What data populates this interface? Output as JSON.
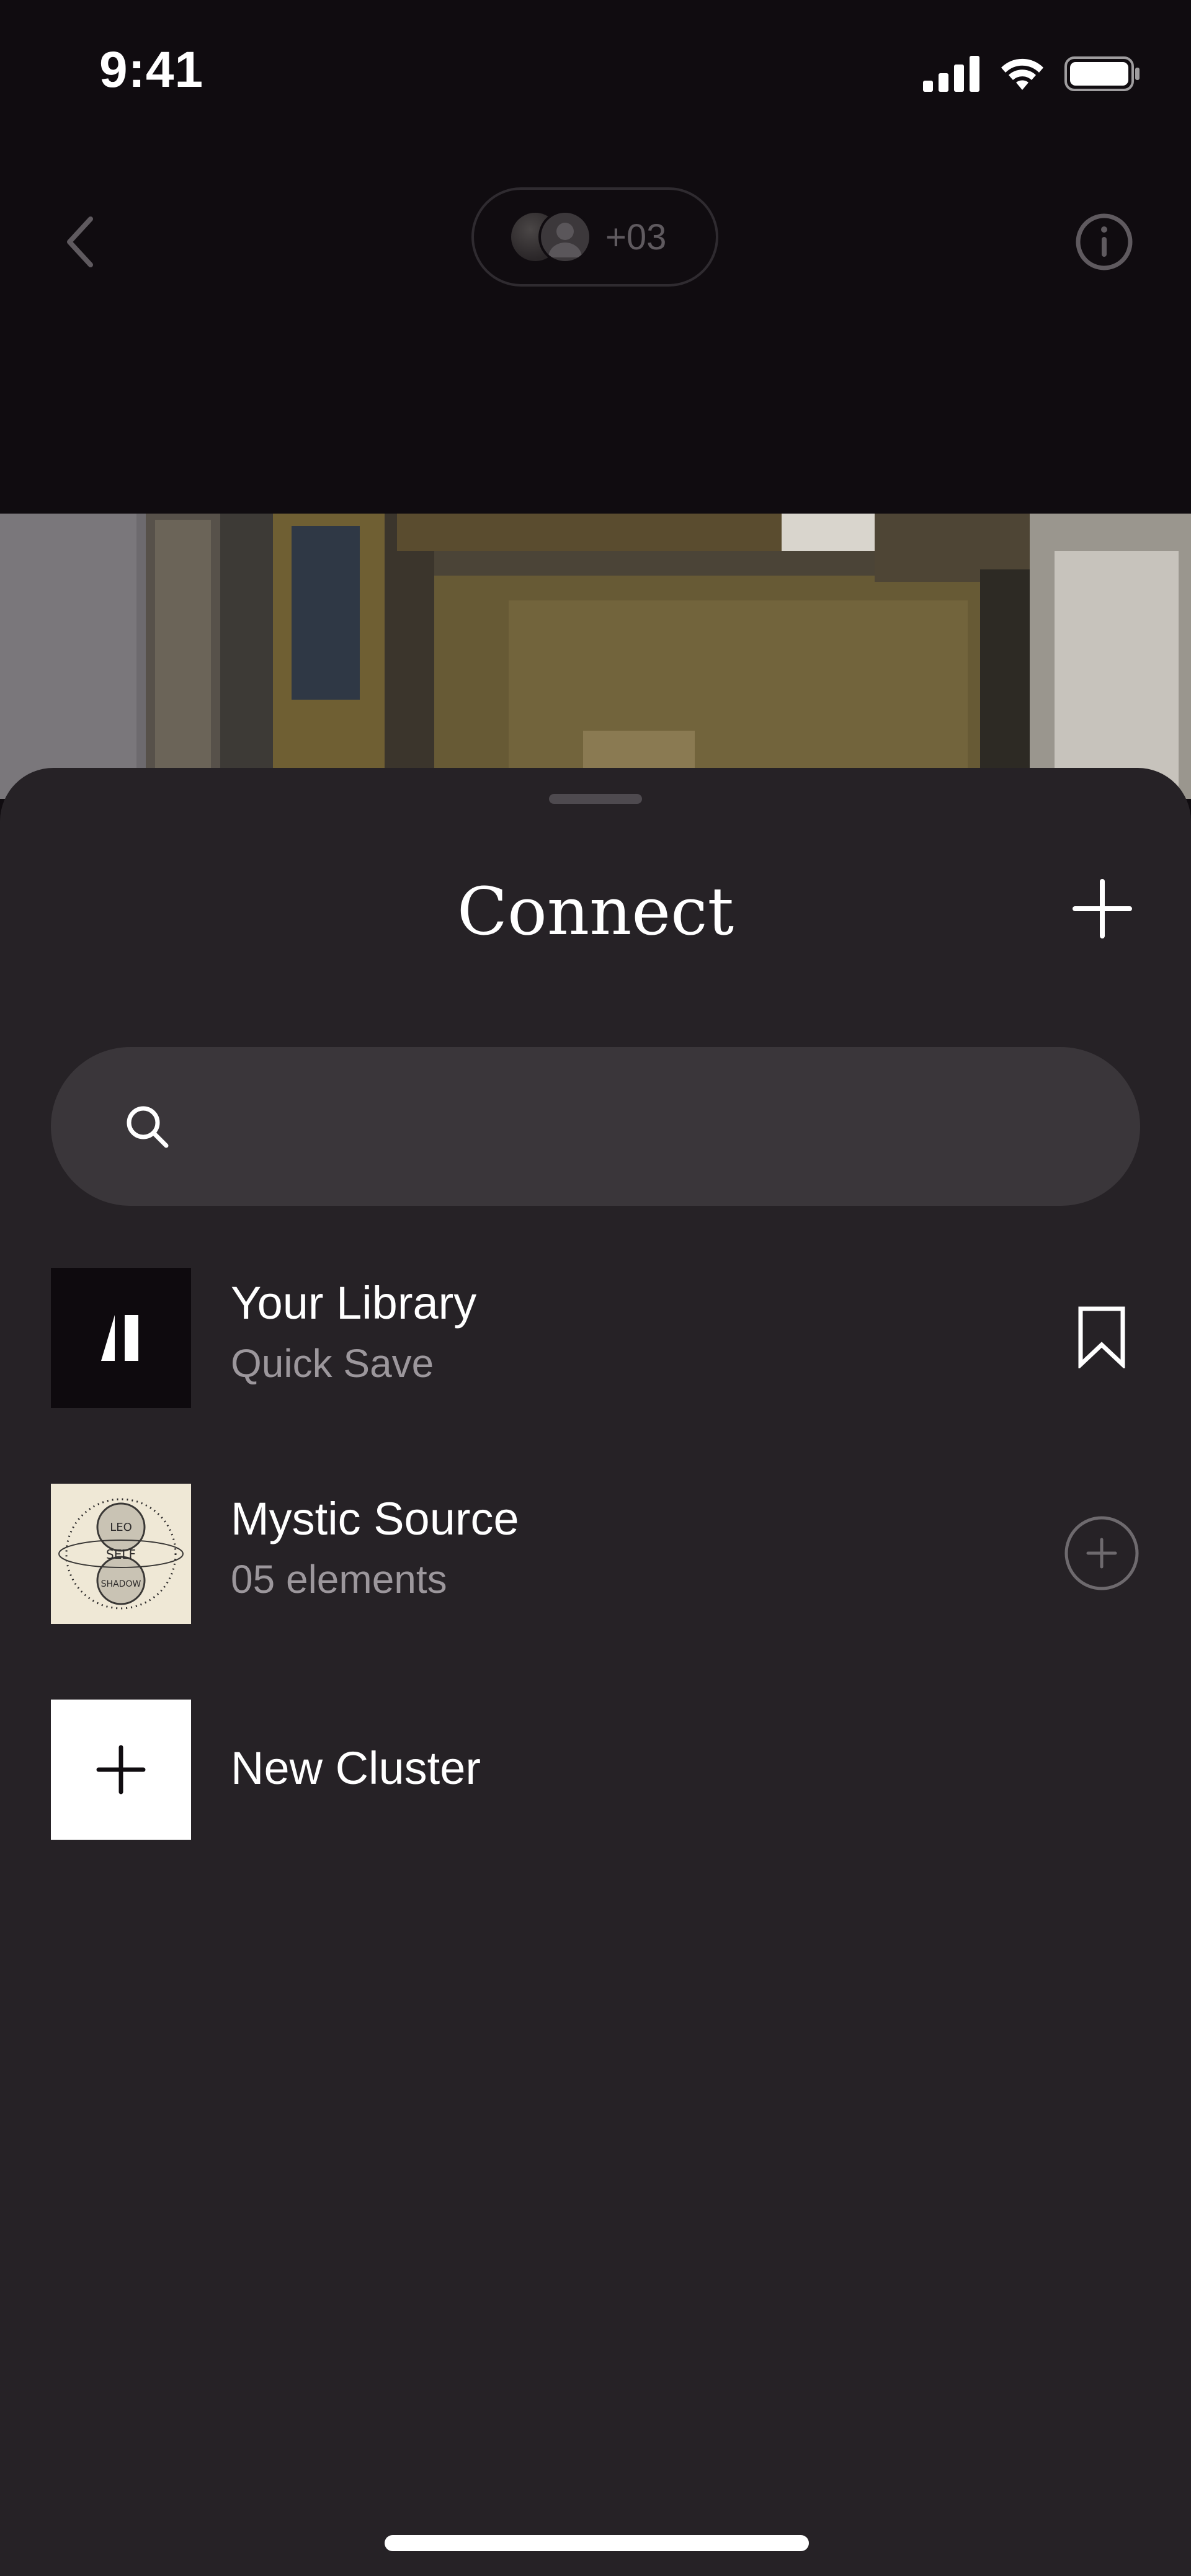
{
  "status_bar": {
    "time": "9:41"
  },
  "top_nav": {
    "participants_count": "+03"
  },
  "sheet": {
    "title": "Connect",
    "search_placeholder": ""
  },
  "items": [
    {
      "title": "Your Library",
      "subtitle": "Quick Save",
      "action_icon": "bookmark-icon"
    },
    {
      "title": "Mystic Source",
      "subtitle": "05 elements",
      "action_icon": "plus-circle-icon",
      "thumbnail_text": [
        "LEO",
        "SELF",
        "SHADOW"
      ]
    },
    {
      "title": "New Cluster",
      "action_icon": "plus-icon"
    }
  ],
  "colors": {
    "background": "#100c10",
    "sheet": "#262226",
    "search": "#3a363a",
    "text_primary": "#ffffff",
    "text_secondary": "#9c979c"
  }
}
